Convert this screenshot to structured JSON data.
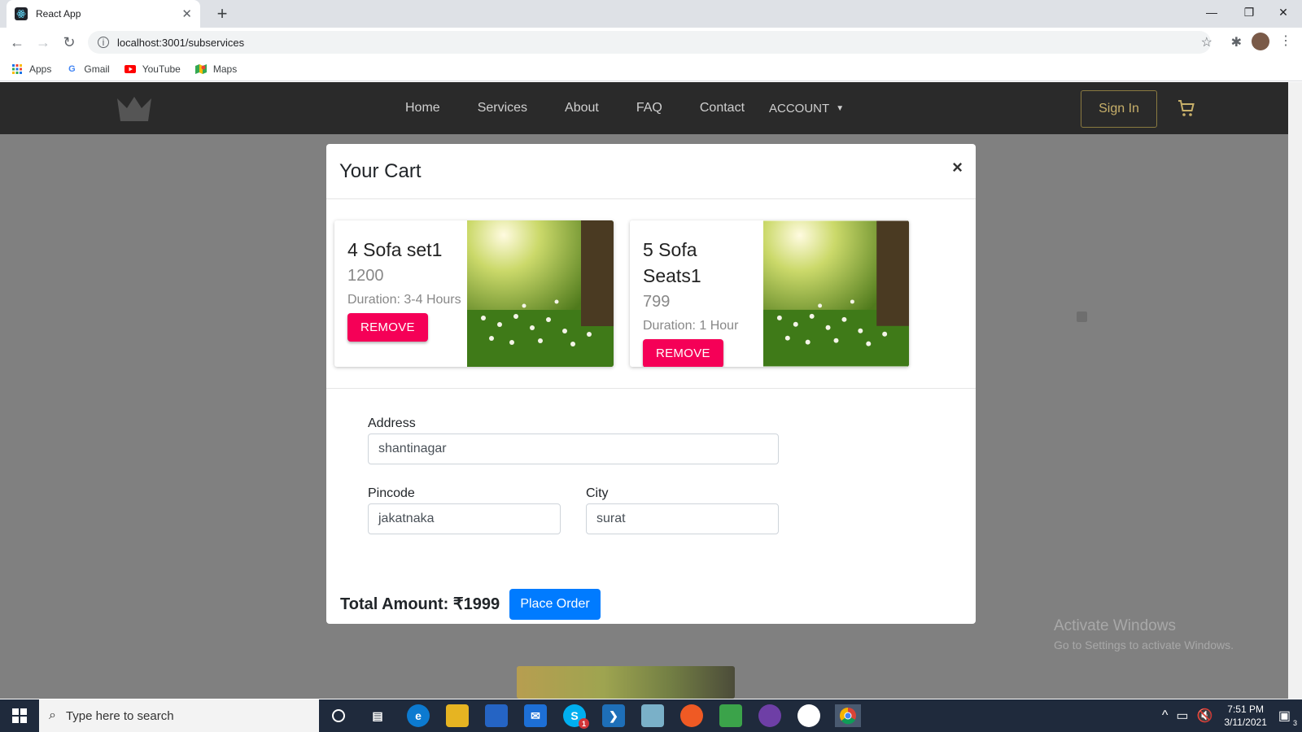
{
  "browser": {
    "tab_title": "React App",
    "url": "localhost:3001/subservices",
    "bookmarks": [
      {
        "label": "Apps",
        "icon": "apps-grid-icon"
      },
      {
        "label": "Gmail",
        "icon": "google-g-icon"
      },
      {
        "label": "YouTube",
        "icon": "youtube-icon"
      },
      {
        "label": "Maps",
        "icon": "maps-pin-icon"
      }
    ]
  },
  "navbar": {
    "links": [
      "Home",
      "Services",
      "About",
      "FAQ",
      "Contact"
    ],
    "account_label": "ACCOUNT",
    "signin_label": "Sign In"
  },
  "modal": {
    "title": "Your Cart",
    "close_label": "×",
    "items": [
      {
        "name": "4 Sofa set1",
        "price": "1200",
        "duration": "Duration: 3-4 Hours",
        "remove_label": "REMOVE"
      },
      {
        "name": "5 Sofa Seats1",
        "price": "799",
        "duration": "Duration: 1 Hour",
        "remove_label": "REMOVE"
      }
    ],
    "form": {
      "address_label": "Address",
      "address_value": "shantinagar",
      "pincode_label": "Pincode",
      "pincode_value": "jakatnaka",
      "city_label": "City",
      "city_value": "surat"
    },
    "total_text": "Total Amount: ₹1999",
    "place_order_label": "Place Order"
  },
  "watermark": {
    "title": "Activate Windows",
    "subtitle": "Go to Settings to activate Windows."
  },
  "taskbar": {
    "search_placeholder": "Type here to search",
    "time": "7:51 PM",
    "date": "3/11/2021",
    "notification_count": "3",
    "skype_badge": "1"
  }
}
